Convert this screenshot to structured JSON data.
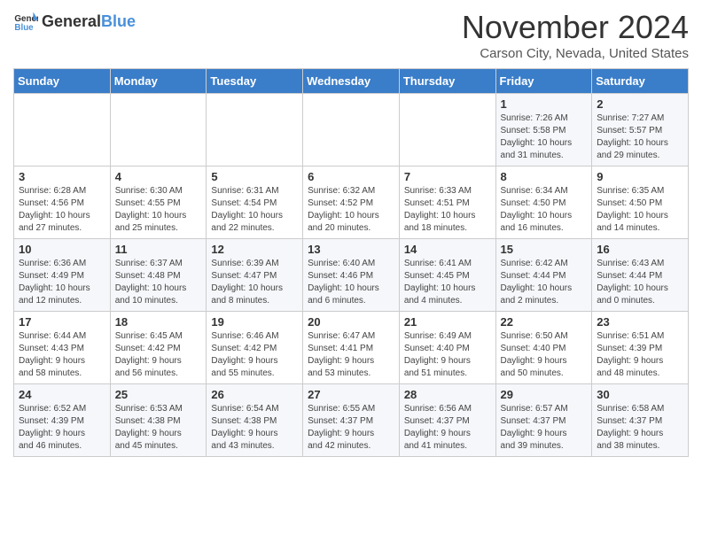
{
  "logo": {
    "general": "General",
    "blue": "Blue"
  },
  "title": "November 2024",
  "subtitle": "Carson City, Nevada, United States",
  "days_of_week": [
    "Sunday",
    "Monday",
    "Tuesday",
    "Wednesday",
    "Thursday",
    "Friday",
    "Saturday"
  ],
  "weeks": [
    [
      {
        "day": "",
        "info": ""
      },
      {
        "day": "",
        "info": ""
      },
      {
        "day": "",
        "info": ""
      },
      {
        "day": "",
        "info": ""
      },
      {
        "day": "",
        "info": ""
      },
      {
        "day": "1",
        "info": "Sunrise: 7:26 AM\nSunset: 5:58 PM\nDaylight: 10 hours\nand 31 minutes."
      },
      {
        "day": "2",
        "info": "Sunrise: 7:27 AM\nSunset: 5:57 PM\nDaylight: 10 hours\nand 29 minutes."
      }
    ],
    [
      {
        "day": "3",
        "info": "Sunrise: 6:28 AM\nSunset: 4:56 PM\nDaylight: 10 hours\nand 27 minutes."
      },
      {
        "day": "4",
        "info": "Sunrise: 6:30 AM\nSunset: 4:55 PM\nDaylight: 10 hours\nand 25 minutes."
      },
      {
        "day": "5",
        "info": "Sunrise: 6:31 AM\nSunset: 4:54 PM\nDaylight: 10 hours\nand 22 minutes."
      },
      {
        "day": "6",
        "info": "Sunrise: 6:32 AM\nSunset: 4:52 PM\nDaylight: 10 hours\nand 20 minutes."
      },
      {
        "day": "7",
        "info": "Sunrise: 6:33 AM\nSunset: 4:51 PM\nDaylight: 10 hours\nand 18 minutes."
      },
      {
        "day": "8",
        "info": "Sunrise: 6:34 AM\nSunset: 4:50 PM\nDaylight: 10 hours\nand 16 minutes."
      },
      {
        "day": "9",
        "info": "Sunrise: 6:35 AM\nSunset: 4:50 PM\nDaylight: 10 hours\nand 14 minutes."
      }
    ],
    [
      {
        "day": "10",
        "info": "Sunrise: 6:36 AM\nSunset: 4:49 PM\nDaylight: 10 hours\nand 12 minutes."
      },
      {
        "day": "11",
        "info": "Sunrise: 6:37 AM\nSunset: 4:48 PM\nDaylight: 10 hours\nand 10 minutes."
      },
      {
        "day": "12",
        "info": "Sunrise: 6:39 AM\nSunset: 4:47 PM\nDaylight: 10 hours\nand 8 minutes."
      },
      {
        "day": "13",
        "info": "Sunrise: 6:40 AM\nSunset: 4:46 PM\nDaylight: 10 hours\nand 6 minutes."
      },
      {
        "day": "14",
        "info": "Sunrise: 6:41 AM\nSunset: 4:45 PM\nDaylight: 10 hours\nand 4 minutes."
      },
      {
        "day": "15",
        "info": "Sunrise: 6:42 AM\nSunset: 4:44 PM\nDaylight: 10 hours\nand 2 minutes."
      },
      {
        "day": "16",
        "info": "Sunrise: 6:43 AM\nSunset: 4:44 PM\nDaylight: 10 hours\nand 0 minutes."
      }
    ],
    [
      {
        "day": "17",
        "info": "Sunrise: 6:44 AM\nSunset: 4:43 PM\nDaylight: 9 hours\nand 58 minutes."
      },
      {
        "day": "18",
        "info": "Sunrise: 6:45 AM\nSunset: 4:42 PM\nDaylight: 9 hours\nand 56 minutes."
      },
      {
        "day": "19",
        "info": "Sunrise: 6:46 AM\nSunset: 4:42 PM\nDaylight: 9 hours\nand 55 minutes."
      },
      {
        "day": "20",
        "info": "Sunrise: 6:47 AM\nSunset: 4:41 PM\nDaylight: 9 hours\nand 53 minutes."
      },
      {
        "day": "21",
        "info": "Sunrise: 6:49 AM\nSunset: 4:40 PM\nDaylight: 9 hours\nand 51 minutes."
      },
      {
        "day": "22",
        "info": "Sunrise: 6:50 AM\nSunset: 4:40 PM\nDaylight: 9 hours\nand 50 minutes."
      },
      {
        "day": "23",
        "info": "Sunrise: 6:51 AM\nSunset: 4:39 PM\nDaylight: 9 hours\nand 48 minutes."
      }
    ],
    [
      {
        "day": "24",
        "info": "Sunrise: 6:52 AM\nSunset: 4:39 PM\nDaylight: 9 hours\nand 46 minutes."
      },
      {
        "day": "25",
        "info": "Sunrise: 6:53 AM\nSunset: 4:38 PM\nDaylight: 9 hours\nand 45 minutes."
      },
      {
        "day": "26",
        "info": "Sunrise: 6:54 AM\nSunset: 4:38 PM\nDaylight: 9 hours\nand 43 minutes."
      },
      {
        "day": "27",
        "info": "Sunrise: 6:55 AM\nSunset: 4:37 PM\nDaylight: 9 hours\nand 42 minutes."
      },
      {
        "day": "28",
        "info": "Sunrise: 6:56 AM\nSunset: 4:37 PM\nDaylight: 9 hours\nand 41 minutes."
      },
      {
        "day": "29",
        "info": "Sunrise: 6:57 AM\nSunset: 4:37 PM\nDaylight: 9 hours\nand 39 minutes."
      },
      {
        "day": "30",
        "info": "Sunrise: 6:58 AM\nSunset: 4:37 PM\nDaylight: 9 hours\nand 38 minutes."
      }
    ]
  ]
}
